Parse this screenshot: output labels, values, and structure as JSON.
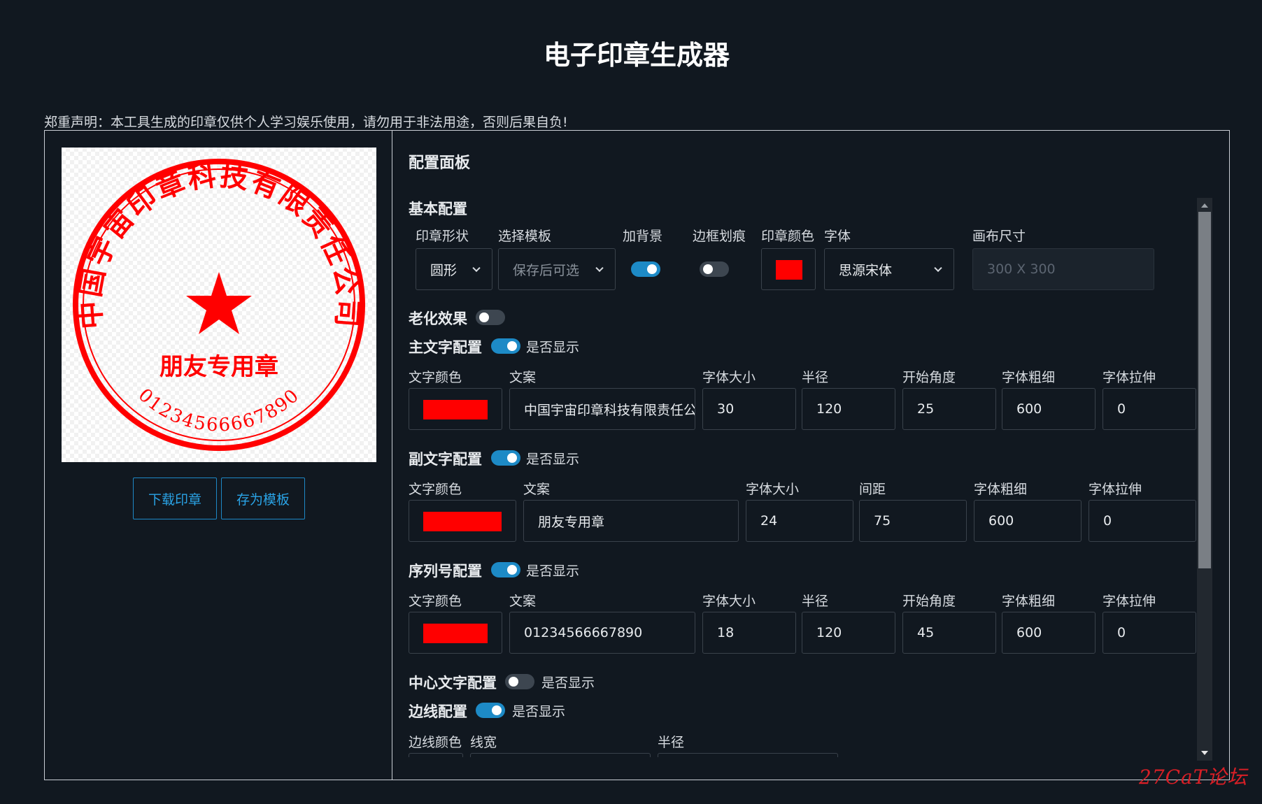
{
  "page_title": "电子印章生成器",
  "disclaimer": "郑重声明：本工具生成的印章仅供个人学习娱乐使用，请勿用于非法用途，否则后果自负!",
  "preview": {
    "seal_main_text": "中国宇宙印章科技有限责任公司",
    "seal_sub_text": "朋友专用章",
    "seal_serial": "01234566667890",
    "seal_color": "#ff0000",
    "download_label": "下载印章",
    "save_template_label": "存为模板"
  },
  "panel": {
    "title": "配置面板",
    "basic": {
      "title": "基本配置",
      "shape_label": "印章形状",
      "shape_value": "圆形",
      "template_label": "选择模板",
      "template_placeholder": "保存后可选",
      "background_label": "加背景",
      "background_on": true,
      "border_scratch_label": "边框划痕",
      "border_scratch_on": false,
      "seal_color_label": "印章颜色",
      "seal_color": "#ff0000",
      "font_label": "字体",
      "font_value": "思源宋体",
      "canvas_label": "画布尺寸",
      "canvas_placeholder": "300 X 300"
    },
    "aging": {
      "title": "老化效果",
      "on": false
    },
    "main_text": {
      "title": "主文字配置",
      "show_label": "是否显示",
      "on": true,
      "labels": [
        "文字颜色",
        "文案",
        "字体大小",
        "半径",
        "开始角度",
        "字体粗细",
        "字体拉伸"
      ],
      "color": "#ff0000",
      "text": "中国宇宙印章科技有限责任公司",
      "font_size": "30",
      "radius": "120",
      "start_angle": "25",
      "font_weight": "600",
      "stretch": "0"
    },
    "sub_text": {
      "title": "副文字配置",
      "show_label": "是否显示",
      "on": true,
      "labels": [
        "文字颜色",
        "文案",
        "字体大小",
        "间距",
        "字体粗细",
        "字体拉伸"
      ],
      "color": "#ff0000",
      "text": "朋友专用章",
      "font_size": "24",
      "spacing": "75",
      "font_weight": "600",
      "stretch": "0"
    },
    "serial": {
      "title": "序列号配置",
      "show_label": "是否显示",
      "on": true,
      "labels": [
        "文字颜色",
        "文案",
        "字体大小",
        "半径",
        "开始角度",
        "字体粗细",
        "字体拉伸"
      ],
      "color": "#ff0000",
      "text": "01234566667890",
      "font_size": "18",
      "radius": "120",
      "start_angle": "45",
      "font_weight": "600",
      "stretch": "0"
    },
    "center_text": {
      "title": "中心文字配置",
      "show_label": "是否显示",
      "on": false
    },
    "border": {
      "title": "边线配置",
      "show_label": "是否显示",
      "on": true,
      "labels": [
        "边线颜色",
        "线宽",
        "半径"
      ]
    }
  },
  "watermark": "27CaT论坛",
  "icons": [
    "chevron-down-icon",
    "star-icon",
    "scroll-up-arrow-icon",
    "scroll-down-arrow-icon"
  ]
}
